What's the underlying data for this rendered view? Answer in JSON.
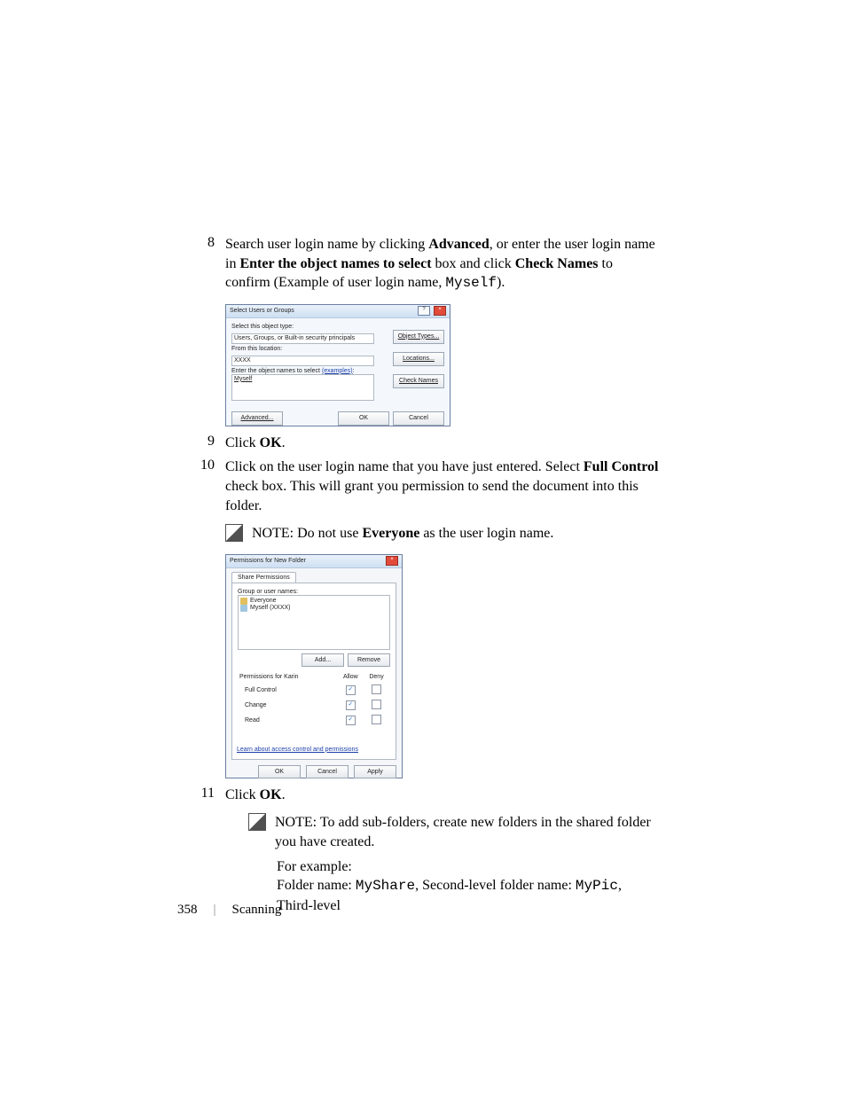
{
  "steps": {
    "s8": {
      "num": "8",
      "t1a": "Search user login name by clicking ",
      "t1b": "Advanced",
      "t1c": ", or enter the user login name in ",
      "t1d": "Enter the object names to select",
      "t1e": " box and click ",
      "t1f": "Check Names",
      "t1g": " to confirm (Example of user login name, ",
      "t1h": "Myself",
      "t1i": ")."
    },
    "s9": {
      "num": "9",
      "a": "Click ",
      "b": "OK",
      "c": "."
    },
    "s10": {
      "num": "10",
      "a": "Click on the user login name that you have just entered. Select ",
      "b": "Full Control",
      "c": " check box. This will grant you permission to send the document into this folder."
    },
    "s11": {
      "num": "11",
      "a": "Click ",
      "b": "OK",
      "c": "."
    }
  },
  "note1": {
    "lead": "NOTE: ",
    "a": "Do not use ",
    "b": "Everyone",
    "c": " as the user login name."
  },
  "note2": {
    "lead": "NOTE: ",
    "a": "To add sub-folders, create new folders in the shared folder you have created."
  },
  "example": {
    "line1": "For example:",
    "line2a": "Folder name: ",
    "line2b": "MyShare",
    "line2c": ", Second-level folder name: ",
    "line2d": "MyPic",
    "line2e": ", Third-level"
  },
  "dlg1": {
    "title": "Select Users or Groups",
    "l_type": "Select this object type:",
    "v_type": "Users, Groups, or Built-in security principals",
    "b_types": "Object Types...",
    "l_loc": "From this location:",
    "v_loc": "XXXX",
    "b_loc": "Locations...",
    "l_names_a": "Enter the object names to select ",
    "l_names_b": "(examples)",
    "l_names_c": ":",
    "v_names": "Myself",
    "b_check": "Check Names",
    "b_adv": "Advanced...",
    "b_ok": "OK",
    "b_cancel": "Cancel"
  },
  "dlg2": {
    "title": "Permissions for New Folder",
    "tab": "Share Permissions",
    "l_group": "Group or user names:",
    "item1": "Everyone",
    "item2": "Myself (XXXX)",
    "b_add": "Add...",
    "b_remove": "Remove",
    "l_perm": "Permissions for Karin",
    "h_allow": "Allow",
    "h_deny": "Deny",
    "p1": "Full Control",
    "p2": "Change",
    "p3": "Read",
    "link": "Learn about access control and permissions",
    "b_ok": "OK",
    "b_cancel": "Cancel",
    "b_apply": "Apply"
  },
  "footer": {
    "page": "358",
    "sep": "|",
    "section": "Scanning"
  }
}
